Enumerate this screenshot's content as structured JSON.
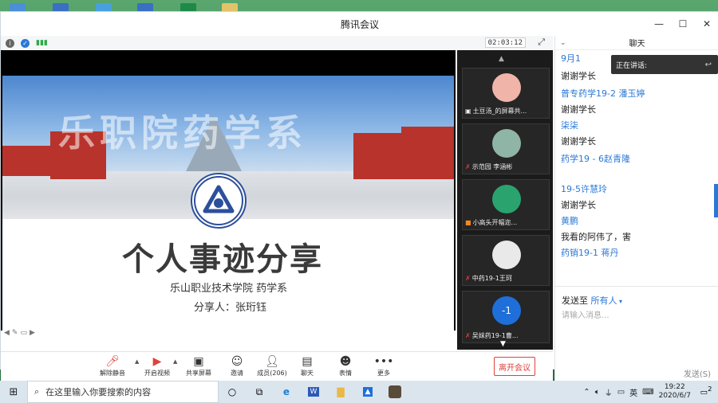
{
  "window": {
    "title": "腾讯会议",
    "minimize": "—",
    "maximize": "☐",
    "close": "✕"
  },
  "meeting": {
    "timer": "02:03:12"
  },
  "slide": {
    "banner": "乐职院药学系",
    "title": "个人事迹分享",
    "subtitle": "乐山职业技术学院  药学系",
    "sharer": "分享人：张珩钰"
  },
  "participants": [
    {
      "name": "土豆汤_的屏幕共...",
      "avatar_color": "#f1b4a9"
    },
    {
      "name": "示范园  李涵彬",
      "avatar_color": "#8fb5a6"
    },
    {
      "name": "小高头开幅迩...",
      "avatar_color": "#2aa36e"
    },
    {
      "name": "中药19-1王珂",
      "avatar_color": "#e9e9e9"
    },
    {
      "name": "吴妹药19-1曹...",
      "avatar_label": "-1",
      "avatar_color": "#1e6fd9"
    }
  ],
  "toolbar": {
    "mute": "解除静音",
    "video": "开启视频",
    "share": "共享屏幕",
    "invite": "邀请",
    "members": "成员(206)",
    "chat": "聊天",
    "emoji": "表情",
    "more": "更多",
    "leave": "离开会议"
  },
  "chat": {
    "title": "聊天",
    "speaking_label": "正在讲话:",
    "messages": [
      {
        "name": "9月1",
        "text": "谢谢学长"
      },
      {
        "name": "普专药学19-2 潘玉婷",
        "text": "谢谢学长"
      },
      {
        "name": "柒柒",
        "text": "谢谢学长"
      },
      {
        "name": "药学19 - 6赵青隆",
        "text": ""
      },
      {
        "name": "19-5许慧玲",
        "text": "谢谢学长"
      },
      {
        "name": "黄鹏",
        "text": "我看的阿伟了，害"
      },
      {
        "name": "药销19-1 蒋丹",
        "text": ""
      }
    ],
    "send_to_label": "发送至",
    "send_to_value": "所有人",
    "input_placeholder": "请输入消息...",
    "send_label": "发送(S)"
  },
  "taskbar": {
    "search_placeholder": "在这里输入你要搜索的内容",
    "ime": "英",
    "time": "19:22",
    "date": "2020/6/7",
    "notifications": "2"
  }
}
